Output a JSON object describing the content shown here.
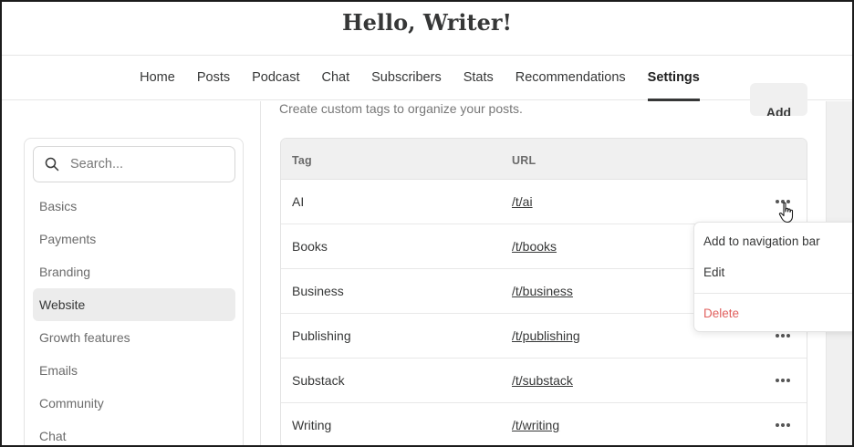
{
  "header": {
    "title": "Hello, Writer!"
  },
  "nav": {
    "tabs": [
      {
        "label": "Home"
      },
      {
        "label": "Posts"
      },
      {
        "label": "Podcast"
      },
      {
        "label": "Chat"
      },
      {
        "label": "Subscribers"
      },
      {
        "label": "Stats"
      },
      {
        "label": "Recommendations"
      },
      {
        "label": "Settings",
        "active": true
      }
    ]
  },
  "sidebar": {
    "search_placeholder": "Search...",
    "items": [
      {
        "label": "Basics"
      },
      {
        "label": "Payments"
      },
      {
        "label": "Branding"
      },
      {
        "label": "Website",
        "active": true
      },
      {
        "label": "Growth features"
      },
      {
        "label": "Emails"
      },
      {
        "label": "Community"
      },
      {
        "label": "Chat"
      }
    ]
  },
  "tags_section": {
    "subtitle": "Create custom tags to organize your posts.",
    "add_label": "Add",
    "columns": {
      "tag": "Tag",
      "url": "URL"
    },
    "rows": [
      {
        "tag": "AI",
        "url": "/t/ai"
      },
      {
        "tag": "Books",
        "url": "/t/books"
      },
      {
        "tag": "Business",
        "url": "/t/business"
      },
      {
        "tag": "Publishing",
        "url": "/t/publishing"
      },
      {
        "tag": "Substack",
        "url": "/t/substack"
      },
      {
        "tag": "Writing",
        "url": "/t/writing"
      }
    ]
  },
  "context_menu": {
    "add_to_nav": "Add to navigation bar",
    "edit": "Edit",
    "delete": "Delete",
    "delete_color": "#e0605e"
  },
  "icons": {
    "search": "search-icon",
    "more": "more-horizontal-icon",
    "cursor": "hand-pointer-icon"
  }
}
